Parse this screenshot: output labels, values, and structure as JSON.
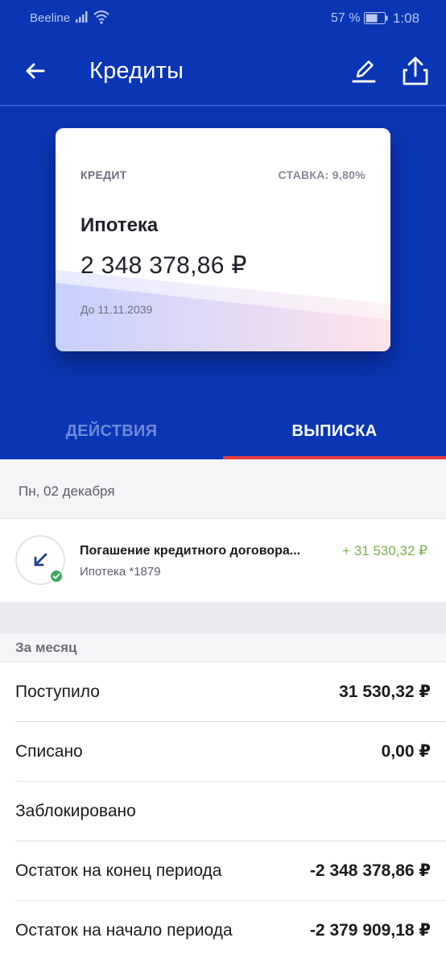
{
  "status_bar": {
    "carrier": "Beeline",
    "battery": "57 %",
    "time": "1:08",
    "icons": [
      "signal-icon",
      "wifi-icon",
      "battery-icon"
    ]
  },
  "app_bar": {
    "title": "Кредиты",
    "icons": [
      "back-arrow-icon",
      "pencil-icon",
      "share-icon"
    ]
  },
  "card": {
    "label": "КРЕДИТ",
    "rate": "СТАВКА: 9,80%",
    "name": "Ипотека",
    "amount": "2 348 378,86 ₽",
    "due": "До 11.11.2039"
  },
  "tabs": [
    {
      "label": "ДЕЙСТВИЯ",
      "active": false
    },
    {
      "label": "ВЫПИСКА",
      "active": true
    }
  ],
  "statement": {
    "date_header": "Пн, 02 декабря",
    "transactions": [
      {
        "title": "Погашение кредитного договора...",
        "subtitle": "Ипотека *1879",
        "amount": "+ 31 530,32 ₽",
        "icon": "incoming-arrow-icon",
        "status_icon": "check-icon"
      }
    ]
  },
  "summary": {
    "header": "За месяц",
    "rows": [
      {
        "label": "Поступило",
        "value": "31 530,32 ₽"
      },
      {
        "label": "Списано",
        "value": "0,00 ₽"
      },
      {
        "label": "Заблокировано",
        "value": ""
      },
      {
        "label": "Остаток на конец периода",
        "value": "-2 348 378,86 ₽"
      },
      {
        "label": "Остаток на начало периода",
        "value": "-2 379 909,18 ₽"
      }
    ]
  },
  "colors": {
    "brand_blue": "#0a35b5",
    "tab_indicator": "#e2383f",
    "income_green": "#7bb04b",
    "success_green": "#3ea861"
  }
}
